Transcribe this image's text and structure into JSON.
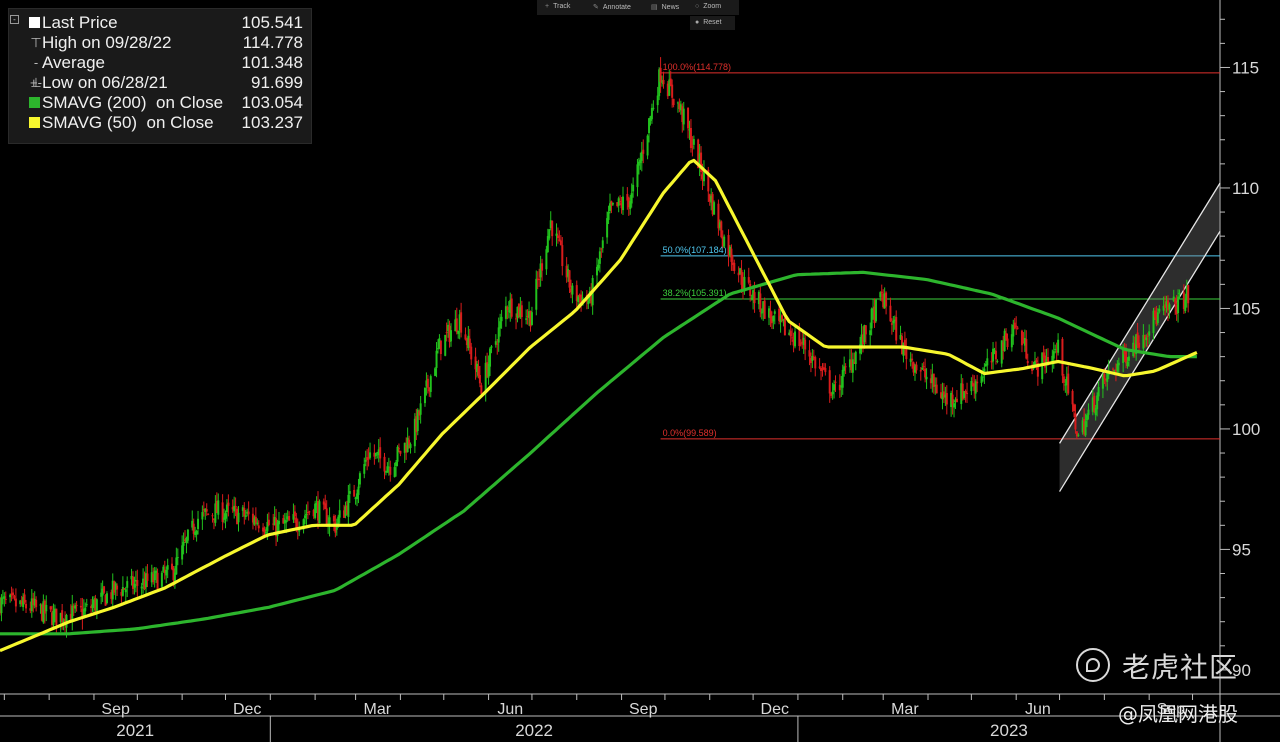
{
  "legend": {
    "items": [
      {
        "icon": "square",
        "color": "#ffffff",
        "label": "Last Price",
        "value": "105.541"
      },
      {
        "icon": "high-marker",
        "label": "High on 09/28/22",
        "value": "114.778"
      },
      {
        "icon": "average-marker",
        "label": "Average",
        "value": "101.348"
      },
      {
        "icon": "low-marker",
        "label": "Low on 06/28/21",
        "value": "91.699"
      },
      {
        "icon": "square",
        "color": "#2db52d",
        "label": "SMAVG (200)  on Close",
        "value": "103.054"
      },
      {
        "icon": "square",
        "color": "#f7f72e",
        "label": "SMAVG (50)  on Close",
        "value": "103.237"
      }
    ]
  },
  "toolbar": {
    "items": [
      {
        "icon": "crosshair-icon",
        "label": "Track"
      },
      {
        "icon": "pencil-icon",
        "label": "Annotate"
      },
      {
        "icon": "news-icon",
        "label": "News"
      },
      {
        "icon": "magnifier-icon",
        "label": "Zoom"
      }
    ],
    "reset_label": "Reset"
  },
  "watermark": {
    "text": "老虎社区",
    "handle": "@凤凰网港股"
  },
  "colors": {
    "background": "#000000",
    "up_candle": "#21c21d",
    "down_candle": "#d91c1c",
    "sma50": "#f7f72e",
    "sma200": "#2db52d",
    "fib_red": "#e0302c",
    "fib_cyan": "#4fc8f0",
    "fib_green": "#3ccf3c"
  },
  "chart_data": {
    "type": "candlestick",
    "title": "",
    "ylim": [
      89,
      117.8
    ],
    "y_ticks": [
      90,
      95,
      100,
      105,
      110,
      115
    ],
    "x_month_labels": [
      "Sep",
      "Dec",
      "Mar",
      "Jun",
      "Sep",
      "Dec",
      "Mar",
      "Jun",
      "Sep"
    ],
    "x_year_labels": [
      "2021",
      "2022",
      "2023"
    ],
    "x_start": "2021-06-28",
    "x_end": "2023-10-20",
    "price_path": [
      [
        "2021-06-28",
        92.8
      ],
      [
        "2021-07-20",
        92.6
      ],
      [
        "2021-08-05",
        92.2
      ],
      [
        "2021-08-25",
        92.4
      ],
      [
        "2021-09-15",
        93.3
      ],
      [
        "2021-10-05",
        93.6
      ],
      [
        "2021-10-25",
        94.0
      ],
      [
        "2021-11-12",
        96.3
      ],
      [
        "2021-11-25",
        96.6
      ],
      [
        "2021-12-15",
        96.4
      ],
      [
        "2022-01-05",
        95.9
      ],
      [
        "2022-01-20",
        96.2
      ],
      [
        "2022-01-31",
        96.8
      ],
      [
        "2022-02-15",
        96.0
      ],
      [
        "2022-03-01",
        97.5
      ],
      [
        "2022-03-10",
        99.0
      ],
      [
        "2022-03-25",
        98.5
      ],
      [
        "2022-04-10",
        99.8
      ],
      [
        "2022-04-28",
        103.4
      ],
      [
        "2022-05-12",
        104.6
      ],
      [
        "2022-05-27",
        101.8
      ],
      [
        "2022-06-14",
        105.2
      ],
      [
        "2022-06-30",
        104.7
      ],
      [
        "2022-07-14",
        108.6
      ],
      [
        "2022-07-29",
        105.6
      ],
      [
        "2022-08-10",
        105.3
      ],
      [
        "2022-08-24",
        109.0
      ],
      [
        "2022-09-08",
        109.6
      ],
      [
        "2022-09-28",
        114.8
      ],
      [
        "2022-10-12",
        113.2
      ],
      [
        "2022-10-25",
        111.0
      ],
      [
        "2022-11-10",
        108.0
      ],
      [
        "2022-11-25",
        106.0
      ],
      [
        "2022-12-15",
        104.5
      ],
      [
        "2023-01-05",
        103.5
      ],
      [
        "2023-01-26",
        101.5
      ],
      [
        "2023-02-14",
        103.6
      ],
      [
        "2023-02-28",
        105.5
      ],
      [
        "2023-03-15",
        103.3
      ],
      [
        "2023-03-30",
        102.2
      ],
      [
        "2023-04-14",
        101.2
      ],
      [
        "2023-04-30",
        101.7
      ],
      [
        "2023-05-15",
        102.8
      ],
      [
        "2023-05-31",
        104.3
      ],
      [
        "2023-06-14",
        102.5
      ],
      [
        "2023-06-30",
        103.3
      ],
      [
        "2023-07-14",
        99.7
      ],
      [
        "2023-08-01",
        102.0
      ],
      [
        "2023-08-20",
        103.4
      ],
      [
        "2023-09-05",
        104.6
      ],
      [
        "2023-09-28",
        105.5
      ]
    ],
    "sma50": [
      [
        "2021-06-28",
        90.8
      ],
      [
        "2021-08-15",
        92.0
      ],
      [
        "2021-09-15",
        92.6
      ],
      [
        "2021-10-20",
        93.4
      ],
      [
        "2021-11-30",
        94.7
      ],
      [
        "2021-12-30",
        95.6
      ],
      [
        "2022-01-31",
        96.0
      ],
      [
        "2022-02-28",
        96.0
      ],
      [
        "2022-03-31",
        97.7
      ],
      [
        "2022-04-30",
        99.8
      ],
      [
        "2022-05-31",
        101.6
      ],
      [
        "2022-06-30",
        103.4
      ],
      [
        "2022-07-31",
        104.9
      ],
      [
        "2022-08-31",
        107.0
      ],
      [
        "2022-09-30",
        109.8
      ],
      [
        "2022-10-20",
        111.2
      ],
      [
        "2022-11-05",
        110.3
      ],
      [
        "2022-11-30",
        107.4
      ],
      [
        "2022-12-25",
        104.5
      ],
      [
        "2023-01-20",
        103.4
      ],
      [
        "2023-02-15",
        103.4
      ],
      [
        "2023-03-15",
        103.4
      ],
      [
        "2023-04-15",
        103.1
      ],
      [
        "2023-05-10",
        102.3
      ],
      [
        "2023-06-05",
        102.5
      ],
      [
        "2023-06-30",
        102.8
      ],
      [
        "2023-07-25",
        102.5
      ],
      [
        "2023-08-15",
        102.2
      ],
      [
        "2023-09-05",
        102.4
      ],
      [
        "2023-10-05",
        103.2
      ]
    ],
    "sma200": [
      [
        "2021-06-28",
        91.5
      ],
      [
        "2021-08-15",
        91.5
      ],
      [
        "2021-09-30",
        91.7
      ],
      [
        "2021-11-15",
        92.1
      ],
      [
        "2021-12-31",
        92.6
      ],
      [
        "2022-02-15",
        93.3
      ],
      [
        "2022-03-31",
        94.8
      ],
      [
        "2022-05-15",
        96.6
      ],
      [
        "2022-06-30",
        99.0
      ],
      [
        "2022-08-15",
        101.5
      ],
      [
        "2022-09-30",
        103.8
      ],
      [
        "2022-11-15",
        105.6
      ],
      [
        "2022-12-31",
        106.4
      ],
      [
        "2023-02-15",
        106.5
      ],
      [
        "2023-03-31",
        106.2
      ],
      [
        "2023-05-15",
        105.6
      ],
      [
        "2023-06-30",
        104.6
      ],
      [
        "2023-08-15",
        103.3
      ],
      [
        "2023-09-15",
        103.0
      ],
      [
        "2023-10-05",
        103.0
      ]
    ],
    "fibonacci": {
      "start_date": "2022-09-28",
      "levels": [
        {
          "label": "100.0%(114.778)",
          "value": 114.778,
          "color": "#e0302c"
        },
        {
          "label": "50.0%(107.184)",
          "value": 107.184,
          "color": "#4fc8f0"
        },
        {
          "label": "38.2%(105.391)",
          "value": 105.391,
          "color": "#3ccf3c"
        },
        {
          "label": "0.0%(99.589)",
          "value": 99.589,
          "color": "#e0302c"
        }
      ]
    },
    "channel": {
      "lower": [
        [
          "2023-07-01",
          97.4
        ],
        [
          "2023-10-20",
          108.2
        ]
      ],
      "upper": [
        [
          "2023-07-01",
          99.4
        ],
        [
          "2023-10-20",
          110.2
        ]
      ]
    },
    "grid": false,
    "legend_position": "top-left"
  }
}
